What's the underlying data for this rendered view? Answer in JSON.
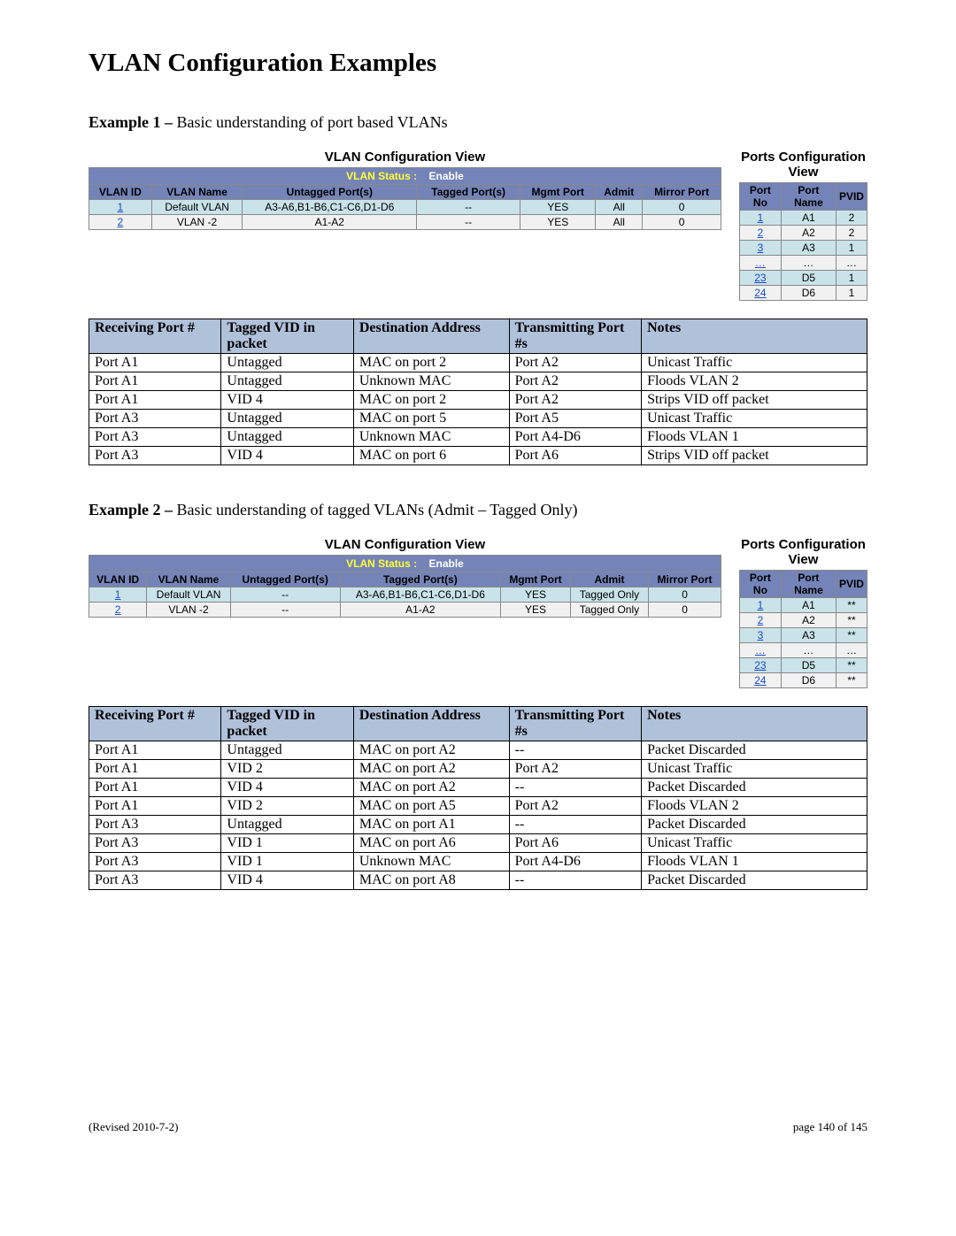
{
  "page_title": "VLAN Configuration Examples",
  "example1": {
    "heading_bold": "Example 1 – ",
    "heading_rest": "Basic understanding of port based VLANs",
    "vlan_caption": "VLAN Configuration View",
    "ports_caption": "Ports Configuration View",
    "vlan_status_label": "VLAN Status   :",
    "vlan_status_value": "Enable",
    "vlan_headers": [
      "VLAN ID",
      "VLAN Name",
      "Untagged Port(s)",
      "Tagged Port(s)",
      "Mgmt Port",
      "Admit",
      "Mirror Port"
    ],
    "vlan_rows": [
      {
        "id": "1",
        "name": "Default VLAN",
        "untagged": "A3-A6,B1-B6,C1-C6,D1-D6",
        "tagged": "--",
        "mgmt": "YES",
        "admit": "All",
        "mirror": "0"
      },
      {
        "id": "2",
        "name": "VLAN -2",
        "untagged": "A1-A2",
        "tagged": "--",
        "mgmt": "YES",
        "admit": "All",
        "mirror": "0"
      }
    ],
    "ports_headers": [
      "Port No",
      "Port Name",
      "PVID"
    ],
    "ports_rows": [
      {
        "no": "1",
        "name": "A1",
        "pvid": "2"
      },
      {
        "no": "2",
        "name": "A2",
        "pvid": "2"
      },
      {
        "no": "3",
        "name": "A3",
        "pvid": "1"
      },
      {
        "no": "…",
        "name": "…",
        "pvid": "…"
      },
      {
        "no": "23",
        "name": "D5",
        "pvid": "1"
      },
      {
        "no": "24",
        "name": "D6",
        "pvid": "1"
      }
    ],
    "traffic_headers": [
      "Receiving Port #",
      "Tagged VID in packet",
      "Destination Address",
      "Transmitting Port #s",
      "Notes"
    ],
    "traffic_rows": [
      [
        "Port A1",
        "Untagged",
        "MAC on port 2",
        "Port A2",
        "Unicast Traffic"
      ],
      [
        "Port A1",
        "Untagged",
        "Unknown MAC",
        "Port A2",
        "Floods VLAN 2"
      ],
      [
        "Port A1",
        "VID 4",
        "MAC on port 2",
        "Port A2",
        "Strips VID off packet"
      ],
      [
        "Port A3",
        "Untagged",
        "MAC on port 5",
        "Port A5",
        "Unicast Traffic"
      ],
      [
        "Port A3",
        "Untagged",
        "Unknown MAC",
        "Port A4-D6",
        "Floods VLAN 1"
      ],
      [
        "Port A3",
        "VID 4",
        "MAC on port 6",
        "Port A6",
        "Strips VID off packet"
      ]
    ]
  },
  "example2": {
    "heading_bold": "Example 2 – ",
    "heading_rest": "Basic understanding of tagged VLANs (Admit – Tagged Only)",
    "vlan_caption": "VLAN Configuration View",
    "ports_caption": "Ports Configuration View",
    "vlan_status_label": "VLAN Status   :",
    "vlan_status_value": "Enable",
    "vlan_headers": [
      "VLAN ID",
      "VLAN Name",
      "Untagged Port(s)",
      "Tagged Port(s)",
      "Mgmt Port",
      "Admit",
      "Mirror Port"
    ],
    "vlan_rows": [
      {
        "id": "1",
        "name": "Default VLAN",
        "untagged": "--",
        "tagged": "A3-A6,B1-B6,C1-C6,D1-D6",
        "mgmt": "YES",
        "admit": "Tagged Only",
        "mirror": "0"
      },
      {
        "id": "2",
        "name": "VLAN -2",
        "untagged": "--",
        "tagged": "A1-A2",
        "mgmt": "YES",
        "admit": "Tagged Only",
        "mirror": "0"
      }
    ],
    "ports_headers": [
      "Port No",
      "Port Name",
      "PVID"
    ],
    "ports_rows": [
      {
        "no": "1",
        "name": "A1",
        "pvid": "**"
      },
      {
        "no": "2",
        "name": "A2",
        "pvid": "**"
      },
      {
        "no": "3",
        "name": "A3",
        "pvid": "**"
      },
      {
        "no": "…",
        "name": "…",
        "pvid": "…"
      },
      {
        "no": "23",
        "name": "D5",
        "pvid": "**"
      },
      {
        "no": "24",
        "name": "D6",
        "pvid": "**"
      }
    ],
    "traffic_headers": [
      "Receiving Port #",
      "Tagged VID in packet",
      "Destination Address",
      "Transmitting Port #s",
      "Notes"
    ],
    "traffic_rows": [
      [
        "Port A1",
        "Untagged",
        "MAC on port A2",
        "--",
        "Packet Discarded"
      ],
      [
        "Port A1",
        "VID 2",
        "MAC on port A2",
        "Port A2",
        "Unicast Traffic"
      ],
      [
        "Port A1",
        "VID 4",
        "MAC on port A2",
        "--",
        "Packet Discarded"
      ],
      [
        "Port A1",
        "VID 2",
        "MAC on port A5",
        "Port A2",
        "Floods VLAN 2"
      ],
      [
        "Port A3",
        "Untagged",
        "MAC on port A1",
        "--",
        "Packet Discarded"
      ],
      [
        "Port A3",
        "VID 1",
        "MAC on port A6",
        "Port A6",
        "Unicast Traffic"
      ],
      [
        "Port A3",
        "VID 1",
        "Unknown MAC",
        "Port A4-D6",
        "Floods VLAN 1"
      ],
      [
        "Port A3",
        "VID 4",
        "MAC on port A8",
        "--",
        "Packet Discarded"
      ]
    ]
  },
  "footer_left": "(Revised 2010-7-2)",
  "footer_right": "page 140 of 145"
}
